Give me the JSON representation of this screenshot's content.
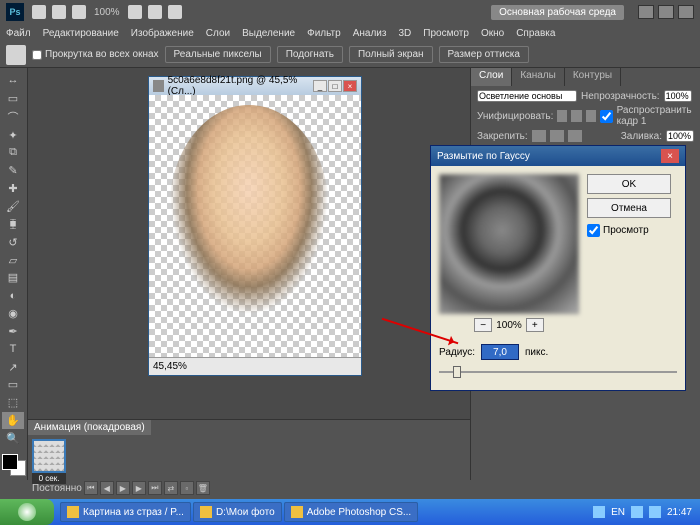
{
  "header": {
    "ps": "Ps",
    "zoom": "100%",
    "workspace": "Основная рабочая среда"
  },
  "menu": [
    "Файл",
    "Редактирование",
    "Изображение",
    "Слои",
    "Выделение",
    "Фильтр",
    "Анализ",
    "3D",
    "Просмотр",
    "Окно",
    "Справка"
  ],
  "optbar": {
    "scroll_all": "Прокрутка во всех окнах",
    "btns": [
      "Реальные пикселы",
      "Подогнать",
      "Полный экран",
      "Размер оттиска"
    ]
  },
  "document": {
    "title": "5c0a6e8d8f21t.png @ 45,5% (Сл...)",
    "status": "45,45%"
  },
  "layers_panel": {
    "tabs": [
      "Слои",
      "Каналы",
      "Контуры"
    ],
    "blend": "Осветление основы",
    "opacity_lbl": "Непрозрачность:",
    "opacity": "100%",
    "unify": "Унифицировать:",
    "propagate": "Распространить кадр 1",
    "lock": "Закрепить:",
    "fill_lbl": "Заливка:",
    "fill": "100%"
  },
  "dialog": {
    "title": "Размытие по Гауссу",
    "ok": "OK",
    "cancel": "Отмена",
    "preview": "Просмотр",
    "zoom": "100%",
    "radius_lbl": "Радиус:",
    "radius_val": "7,0",
    "radius_unit": "пикс."
  },
  "animation": {
    "tab": "Анимация (покадровая)",
    "frame_time": "0 сек.",
    "loop": "Постоянно"
  },
  "taskbar": {
    "items": [
      "Картина из страз / P...",
      "D:\\Мои фото",
      "Adobe Photoshop CS..."
    ],
    "lang": "EN",
    "time": "21:47"
  }
}
